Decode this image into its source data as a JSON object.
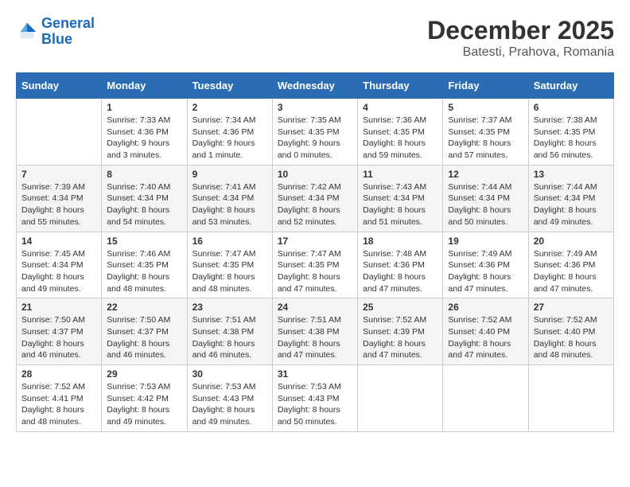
{
  "header": {
    "logo_line1": "General",
    "logo_line2": "Blue",
    "month_year": "December 2025",
    "location": "Batesti, Prahova, Romania"
  },
  "weekdays": [
    "Sunday",
    "Monday",
    "Tuesday",
    "Wednesday",
    "Thursday",
    "Friday",
    "Saturday"
  ],
  "weeks": [
    [
      {
        "day": "",
        "info": ""
      },
      {
        "day": "1",
        "info": "Sunrise: 7:33 AM\nSunset: 4:36 PM\nDaylight: 9 hours\nand 3 minutes."
      },
      {
        "day": "2",
        "info": "Sunrise: 7:34 AM\nSunset: 4:36 PM\nDaylight: 9 hours\nand 1 minute."
      },
      {
        "day": "3",
        "info": "Sunrise: 7:35 AM\nSunset: 4:35 PM\nDaylight: 9 hours\nand 0 minutes."
      },
      {
        "day": "4",
        "info": "Sunrise: 7:36 AM\nSunset: 4:35 PM\nDaylight: 8 hours\nand 59 minutes."
      },
      {
        "day": "5",
        "info": "Sunrise: 7:37 AM\nSunset: 4:35 PM\nDaylight: 8 hours\nand 57 minutes."
      },
      {
        "day": "6",
        "info": "Sunrise: 7:38 AM\nSunset: 4:35 PM\nDaylight: 8 hours\nand 56 minutes."
      }
    ],
    [
      {
        "day": "7",
        "info": "Sunrise: 7:39 AM\nSunset: 4:34 PM\nDaylight: 8 hours\nand 55 minutes."
      },
      {
        "day": "8",
        "info": "Sunrise: 7:40 AM\nSunset: 4:34 PM\nDaylight: 8 hours\nand 54 minutes."
      },
      {
        "day": "9",
        "info": "Sunrise: 7:41 AM\nSunset: 4:34 PM\nDaylight: 8 hours\nand 53 minutes."
      },
      {
        "day": "10",
        "info": "Sunrise: 7:42 AM\nSunset: 4:34 PM\nDaylight: 8 hours\nand 52 minutes."
      },
      {
        "day": "11",
        "info": "Sunrise: 7:43 AM\nSunset: 4:34 PM\nDaylight: 8 hours\nand 51 minutes."
      },
      {
        "day": "12",
        "info": "Sunrise: 7:44 AM\nSunset: 4:34 PM\nDaylight: 8 hours\nand 50 minutes."
      },
      {
        "day": "13",
        "info": "Sunrise: 7:44 AM\nSunset: 4:34 PM\nDaylight: 8 hours\nand 49 minutes."
      }
    ],
    [
      {
        "day": "14",
        "info": "Sunrise: 7:45 AM\nSunset: 4:34 PM\nDaylight: 8 hours\nand 49 minutes."
      },
      {
        "day": "15",
        "info": "Sunrise: 7:46 AM\nSunset: 4:35 PM\nDaylight: 8 hours\nand 48 minutes."
      },
      {
        "day": "16",
        "info": "Sunrise: 7:47 AM\nSunset: 4:35 PM\nDaylight: 8 hours\nand 48 minutes."
      },
      {
        "day": "17",
        "info": "Sunrise: 7:47 AM\nSunset: 4:35 PM\nDaylight: 8 hours\nand 47 minutes."
      },
      {
        "day": "18",
        "info": "Sunrise: 7:48 AM\nSunset: 4:36 PM\nDaylight: 8 hours\nand 47 minutes."
      },
      {
        "day": "19",
        "info": "Sunrise: 7:49 AM\nSunset: 4:36 PM\nDaylight: 8 hours\nand 47 minutes."
      },
      {
        "day": "20",
        "info": "Sunrise: 7:49 AM\nSunset: 4:36 PM\nDaylight: 8 hours\nand 47 minutes."
      }
    ],
    [
      {
        "day": "21",
        "info": "Sunrise: 7:50 AM\nSunset: 4:37 PM\nDaylight: 8 hours\nand 46 minutes."
      },
      {
        "day": "22",
        "info": "Sunrise: 7:50 AM\nSunset: 4:37 PM\nDaylight: 8 hours\nand 46 minutes."
      },
      {
        "day": "23",
        "info": "Sunrise: 7:51 AM\nSunset: 4:38 PM\nDaylight: 8 hours\nand 46 minutes."
      },
      {
        "day": "24",
        "info": "Sunrise: 7:51 AM\nSunset: 4:38 PM\nDaylight: 8 hours\nand 47 minutes."
      },
      {
        "day": "25",
        "info": "Sunrise: 7:52 AM\nSunset: 4:39 PM\nDaylight: 8 hours\nand 47 minutes."
      },
      {
        "day": "26",
        "info": "Sunrise: 7:52 AM\nSunset: 4:40 PM\nDaylight: 8 hours\nand 47 minutes."
      },
      {
        "day": "27",
        "info": "Sunrise: 7:52 AM\nSunset: 4:40 PM\nDaylight: 8 hours\nand 48 minutes."
      }
    ],
    [
      {
        "day": "28",
        "info": "Sunrise: 7:52 AM\nSunset: 4:41 PM\nDaylight: 8 hours\nand 48 minutes."
      },
      {
        "day": "29",
        "info": "Sunrise: 7:53 AM\nSunset: 4:42 PM\nDaylight: 8 hours\nand 49 minutes."
      },
      {
        "day": "30",
        "info": "Sunrise: 7:53 AM\nSunset: 4:43 PM\nDaylight: 8 hours\nand 49 minutes."
      },
      {
        "day": "31",
        "info": "Sunrise: 7:53 AM\nSunset: 4:43 PM\nDaylight: 8 hours\nand 50 minutes."
      },
      {
        "day": "",
        "info": ""
      },
      {
        "day": "",
        "info": ""
      },
      {
        "day": "",
        "info": ""
      }
    ]
  ]
}
